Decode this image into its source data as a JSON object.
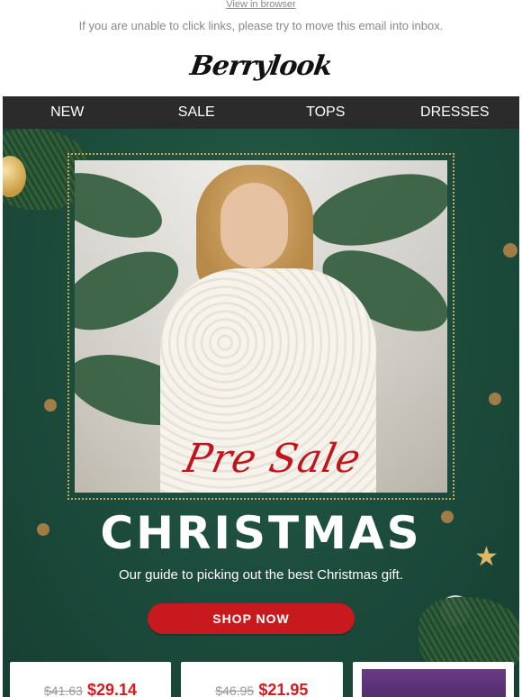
{
  "header": {
    "view_in_browser": "View in browser",
    "unable_text": "If you are unable to click links, please try to move this email into inbox.",
    "logo": "Berrylook"
  },
  "nav": {
    "items": [
      "NEW",
      "SALE",
      "TOPS",
      "DRESSES"
    ]
  },
  "hero": {
    "overlay_text": "Pre Sale",
    "headline": "CHRISTMAS",
    "subtitle": "Our guide to picking out the best Christmas gift.",
    "cta": "SHOP NOW",
    "colors": {
      "background": "#1b4a3b",
      "cta": "#c8191e",
      "accent": "#c2151b"
    }
  },
  "products": [
    {
      "old_price": "$41.63",
      "new_price": "$29.14"
    },
    {
      "old_price": "$46.95",
      "new_price": "$21.95"
    },
    {
      "image": "product-thumbnail"
    }
  ]
}
